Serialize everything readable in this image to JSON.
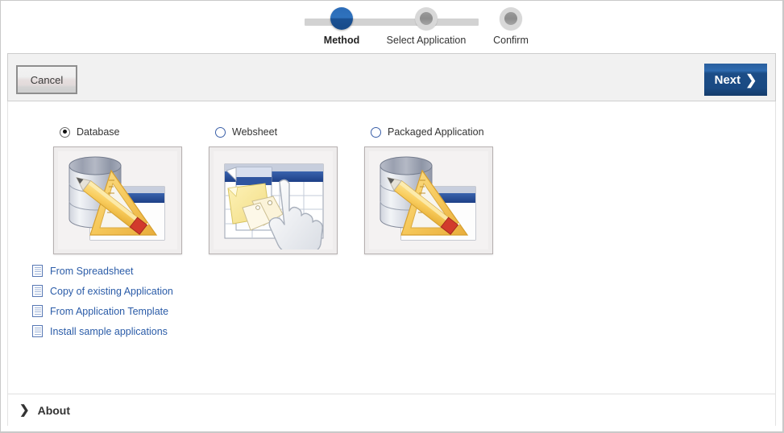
{
  "wizard": {
    "steps": [
      {
        "label": "Method",
        "state": "active"
      },
      {
        "label": "Select Application",
        "state": "inactive"
      },
      {
        "label": "Confirm",
        "state": "inactive"
      }
    ]
  },
  "toolbar": {
    "cancel_label": "Cancel",
    "next_label": "Next",
    "next_chevron": "❯"
  },
  "methods": [
    {
      "label": "Database",
      "selected": true,
      "icon": "database-app-icon",
      "radio": "radio-selected"
    },
    {
      "label": "Websheet",
      "selected": false,
      "icon": "websheet-icon",
      "radio": "radio-unselected"
    },
    {
      "label": "Packaged Application",
      "selected": false,
      "icon": "database-app-icon",
      "radio": "radio-unselected"
    }
  ],
  "links": [
    {
      "label": "From Spreadsheet",
      "icon": "document-icon"
    },
    {
      "label": "Copy of existing Application",
      "icon": "document-icon"
    },
    {
      "label": "From Application Template",
      "icon": "document-icon"
    },
    {
      "label": "Install sample applications",
      "icon": "document-icon"
    }
  ],
  "about": {
    "label": "About",
    "chevron": "❯"
  },
  "colors": {
    "active_step": "#2b6cb8",
    "inactive_step": "#9a9a9a",
    "track": "#d2d2d2",
    "next_button": "#1c4d87",
    "link_text": "#2b5ca8",
    "radio_outline": "#3a5fa8",
    "toolbar_bg": "#f1f1f1",
    "tile_bg": "#efeded"
  }
}
